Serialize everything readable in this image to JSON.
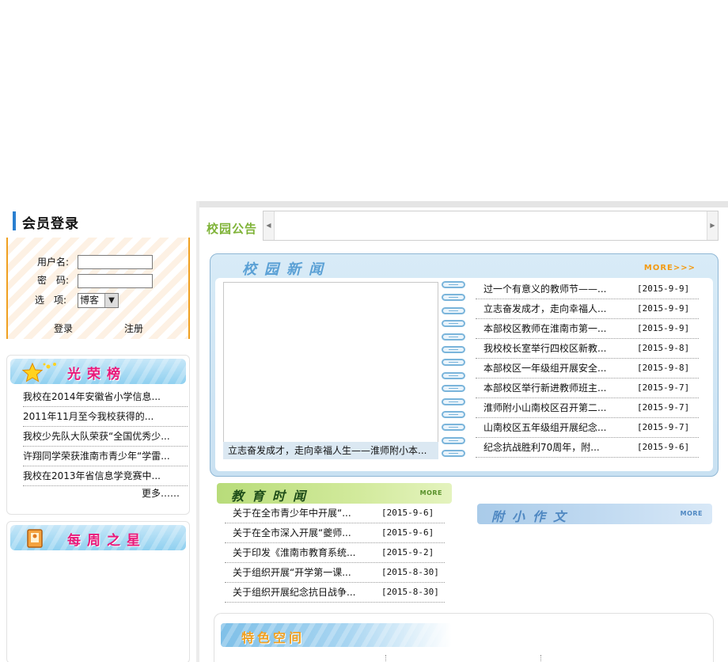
{
  "login": {
    "title": "会员登录",
    "username_label": "用户名:",
    "password_label": "密　码:",
    "option_label": "选　项:",
    "option_value": "博客",
    "login_button": "登录",
    "register_button": "注册"
  },
  "honor": {
    "title": "光荣榜",
    "items": [
      "我校在2014年安徽省小学信息...",
      "2011年11月至今我校获得的...",
      "我校少先队大队荣获“全国优秀少...",
      "许翔同学荣获淮南市青少年“学雷...",
      "我校在2013年省信息学竞赛中..."
    ],
    "more": "更多……"
  },
  "weekly_star": {
    "title": "每周之星"
  },
  "notice": {
    "label": "校园公告"
  },
  "news": {
    "title": "校园新闻",
    "more": "MORE>>>",
    "caption": "立志奋发成才，走向幸福人生——淮师附小本...",
    "items": [
      {
        "title": "过一个有意义的教师节——...",
        "date": "[2015-9-9]"
      },
      {
        "title": "立志奋发成才，走向幸福人...",
        "date": "[2015-9-9]"
      },
      {
        "title": "本部校区教师在淮南市第一...",
        "date": "[2015-9-9]"
      },
      {
        "title": "我校校长室举行四校区新教...",
        "date": "[2015-9-8]"
      },
      {
        "title": "本部校区一年级组开展安全...",
        "date": "[2015-9-8]"
      },
      {
        "title": "本部校区举行新进教师班主...",
        "date": "[2015-9-7]"
      },
      {
        "title": "淮师附小山南校区召开第二...",
        "date": "[2015-9-7]"
      },
      {
        "title": "山南校区五年级组开展纪念...",
        "date": "[2015-9-7]"
      },
      {
        "title": "纪念抗战胜利70周年，附...",
        "date": "[2015-9-6]"
      }
    ]
  },
  "edu": {
    "title": "教育时闻",
    "more": "MORE",
    "items": [
      {
        "title": "关于在全市青少年中开展“...",
        "date": "[2015-9-6]"
      },
      {
        "title": "关于在全市深入开展“夔师...",
        "date": "[2015-9-6]"
      },
      {
        "title": "关于印发《淮南市教育系统...",
        "date": "[2015-9-2]"
      },
      {
        "title": "关于组织开展“开学第一课...",
        "date": "[2015-8-30]"
      },
      {
        "title": "关于组织开展纪念抗日战争...",
        "date": "[2015-8-30]"
      }
    ]
  },
  "composition": {
    "title": "附小作文",
    "more": "MORE"
  },
  "feature": {
    "title": "特色空间"
  }
}
